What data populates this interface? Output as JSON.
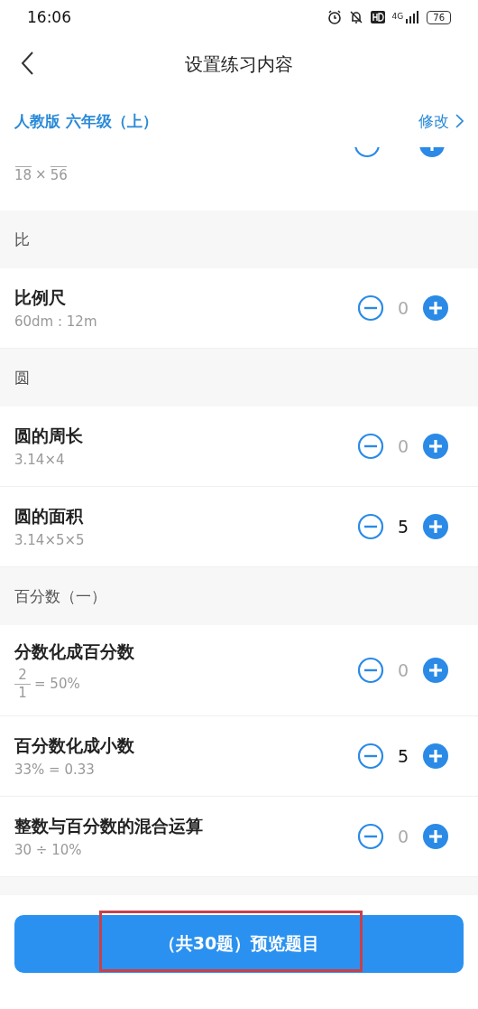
{
  "status_bar": {
    "time": "16:06",
    "battery": "76",
    "network": "4G"
  },
  "header": {
    "title": "设置练习内容"
  },
  "textbook": {
    "label": "人教版 六年级（上）",
    "action": "修改"
  },
  "partial_row": {
    "formula": [
      {
        "kind": "frac",
        "den": "18"
      },
      {
        "kind": "text",
        "text": "×"
      },
      {
        "kind": "frac",
        "den": "56"
      }
    ]
  },
  "sections": [
    {
      "title": "比",
      "items": [
        {
          "name": "比例尺",
          "formula": [
            {
              "kind": "text",
              "text": "60dm : 12m"
            }
          ],
          "count": "0",
          "dimmed": true
        }
      ]
    },
    {
      "title": "圆",
      "items": [
        {
          "name": "圆的周长",
          "formula": [
            {
              "kind": "text",
              "text": "3.14×4"
            }
          ],
          "count": "0",
          "dimmed": true
        },
        {
          "name": "圆的面积",
          "formula": [
            {
              "kind": "text",
              "text": "3.14×5×5"
            }
          ],
          "count": "5",
          "dimmed": false
        }
      ]
    },
    {
      "title": "百分数（一）",
      "items": [
        {
          "name": "分数化成百分数",
          "formula": [
            {
              "kind": "frac",
              "num": "2",
              "den": "1"
            },
            {
              "kind": "text",
              "text": "= 50%"
            }
          ],
          "count": "0",
          "dimmed": true
        },
        {
          "name": "百分数化成小数",
          "formula": [
            {
              "kind": "text",
              "text": "33% = 0.33"
            }
          ],
          "count": "5",
          "dimmed": false
        },
        {
          "name": "整数与百分数的混合运算",
          "formula": [
            {
              "kind": "text",
              "text": "30 ÷ 10%"
            }
          ],
          "count": "0",
          "dimmed": true
        }
      ]
    }
  ],
  "preview_button": {
    "label": "（共30题）预览题目",
    "highlighted": true
  }
}
